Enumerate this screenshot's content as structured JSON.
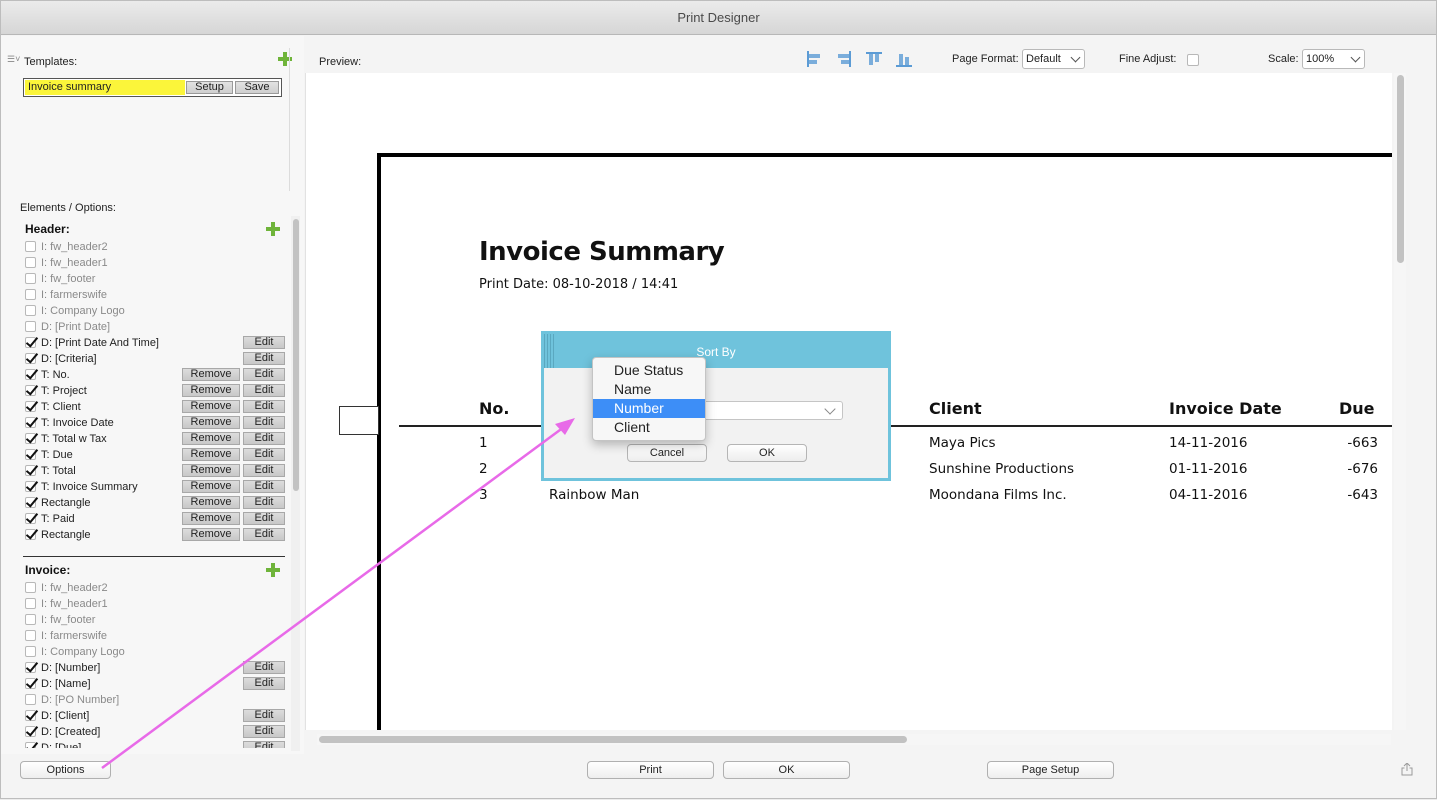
{
  "window": {
    "title": "Print Designer"
  },
  "templates": {
    "label": "Templates:",
    "selected": "Invoice summary",
    "setup_label": "Setup",
    "save_label": "Save"
  },
  "elements": {
    "label": "Elements / Options:",
    "remove_label": "Remove",
    "edit_label": "Edit",
    "header_group": {
      "title": "Header:",
      "items": [
        {
          "label": "I:   fw_header2",
          "checked": false,
          "remove": false,
          "edit": false
        },
        {
          "label": "I:   fw_header1",
          "checked": false,
          "remove": false,
          "edit": false
        },
        {
          "label": "I:   fw_footer",
          "checked": false,
          "remove": false,
          "edit": false
        },
        {
          "label": "I:   farmerswife",
          "checked": false,
          "remove": false,
          "edit": false
        },
        {
          "label": "I:   Company Logo",
          "checked": false,
          "remove": false,
          "edit": false
        },
        {
          "label": "D: [Print Date]",
          "checked": false,
          "remove": false,
          "edit": false
        },
        {
          "label": "D: [Print Date And Time]",
          "checked": true,
          "remove": false,
          "edit": true
        },
        {
          "label": "D: [Criteria]",
          "checked": true,
          "remove": false,
          "edit": true
        },
        {
          "label": "T:  No.",
          "checked": true,
          "remove": true,
          "edit": true
        },
        {
          "label": "T:  Project",
          "checked": true,
          "remove": true,
          "edit": true
        },
        {
          "label": "T:  Client",
          "checked": true,
          "remove": true,
          "edit": true
        },
        {
          "label": "T:  Invoice Date",
          "checked": true,
          "remove": true,
          "edit": true
        },
        {
          "label": "T:  Total w Tax",
          "checked": true,
          "remove": true,
          "edit": true
        },
        {
          "label": "T:  Due",
          "checked": true,
          "remove": true,
          "edit": true
        },
        {
          "label": "T:  Total",
          "checked": true,
          "remove": true,
          "edit": true
        },
        {
          "label": "T:  Invoice Summary",
          "checked": true,
          "remove": true,
          "edit": true
        },
        {
          "label": "Rectangle",
          "checked": true,
          "remove": true,
          "edit": true
        },
        {
          "label": "T:  Paid",
          "checked": true,
          "remove": true,
          "edit": true
        },
        {
          "label": "Rectangle",
          "checked": true,
          "remove": true,
          "edit": true
        }
      ]
    },
    "invoice_group": {
      "title": "Invoice:",
      "items": [
        {
          "label": "I:   fw_header2",
          "checked": false,
          "remove": false,
          "edit": false
        },
        {
          "label": "I:   fw_header1",
          "checked": false,
          "remove": false,
          "edit": false
        },
        {
          "label": "I:   fw_footer",
          "checked": false,
          "remove": false,
          "edit": false
        },
        {
          "label": "I:   farmerswife",
          "checked": false,
          "remove": false,
          "edit": false
        },
        {
          "label": "I:   Company Logo",
          "checked": false,
          "remove": false,
          "edit": false
        },
        {
          "label": "D: [Number]",
          "checked": true,
          "remove": false,
          "edit": true
        },
        {
          "label": "D: [Name]",
          "checked": true,
          "remove": false,
          "edit": true
        },
        {
          "label": "D: [PO Number]",
          "checked": false,
          "remove": false,
          "edit": false
        },
        {
          "label": "D: [Client]",
          "checked": true,
          "remove": false,
          "edit": true
        },
        {
          "label": "D: [Created]",
          "checked": true,
          "remove": false,
          "edit": true
        },
        {
          "label": "D: [Due]",
          "checked": true,
          "remove": false,
          "edit": true
        }
      ]
    }
  },
  "preview": {
    "label": "Preview:",
    "page_format_label": "Page Format:",
    "page_format_value": "Default",
    "fine_adjust_label": "Fine Adjust:",
    "fine_adjust_checked": false,
    "scale_label": "Scale:",
    "scale_value": "100%",
    "align_icons": [
      "align-left-icon",
      "align-right-icon",
      "align-top-icon",
      "align-bottom-icon"
    ],
    "accent_color": "#5b9bd5"
  },
  "document": {
    "title": "Invoice Summary",
    "print_date": "Print Date: 08-10-2018 / 14:41",
    "columns": {
      "no": "No.",
      "client": "Client",
      "invoice_date": "Invoice Date",
      "due": "Due"
    },
    "rows": [
      {
        "no": "1",
        "name": "",
        "client": "Maya Pics",
        "invoice_date": "14-11-2016",
        "due": "-663"
      },
      {
        "no": "2",
        "name": "",
        "client": "Sunshine Productions",
        "invoice_date": "01-11-2016",
        "due": "-676"
      },
      {
        "no": "3",
        "name": "Rainbow Man",
        "client": "Moondana Films Inc.",
        "invoice_date": "04-11-2016",
        "due": "-643"
      }
    ]
  },
  "sort_dialog": {
    "title": "Sort By",
    "title_color": "#6fc3dc",
    "cancel_label": "Cancel",
    "ok_label": "OK",
    "options": [
      "Due Status",
      "Name",
      "Number",
      "Client"
    ],
    "selected": "Number",
    "highlight_color": "#3d8ef7"
  },
  "annotation": {
    "arrow_color": "#e86ae8"
  },
  "bottom_bar": {
    "options_label": "Options",
    "print_label": "Print",
    "ok_label": "OK",
    "page_setup_label": "Page Setup"
  }
}
